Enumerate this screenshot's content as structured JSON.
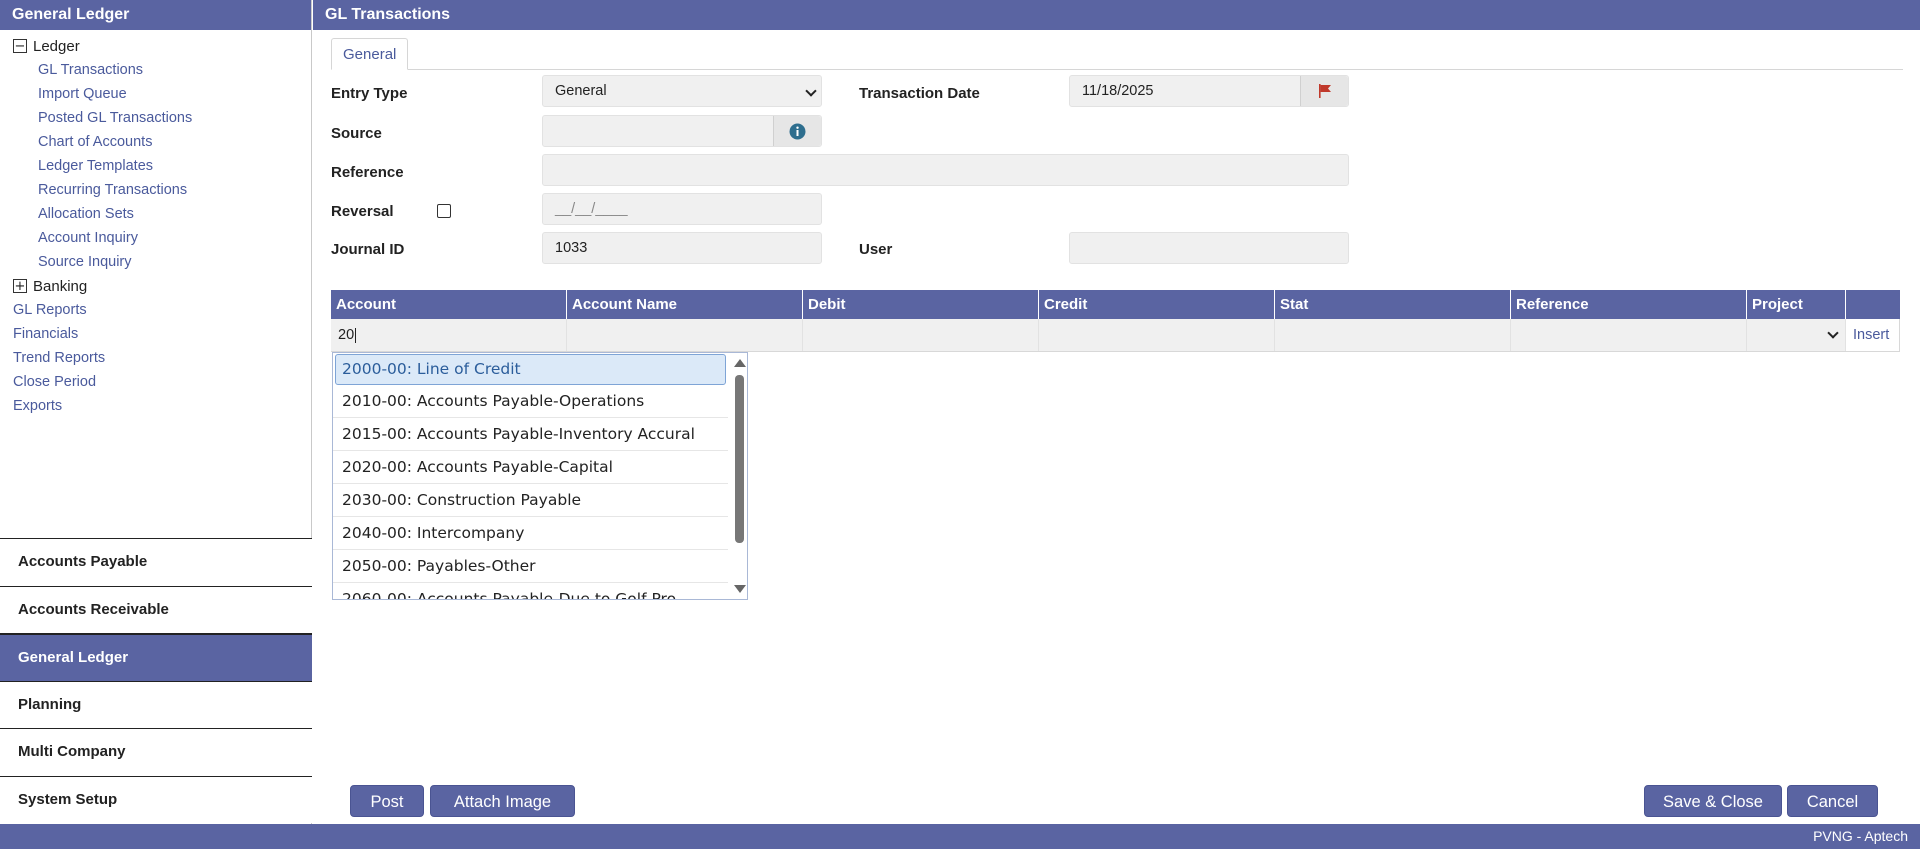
{
  "sidebar": {
    "title": "General Ledger",
    "ledger": {
      "toggle": "−",
      "label": "Ledger"
    },
    "ledger_items": [
      "GL Transactions",
      "Import Queue",
      "Posted GL Transactions",
      "Chart of Accounts",
      "Ledger Templates",
      "Recurring Transactions",
      "Allocation Sets",
      "Account Inquiry",
      "Source Inquiry"
    ],
    "banking": {
      "toggle": "+",
      "label": "Banking"
    },
    "top_links": [
      "GL Reports",
      "Financials",
      "Trend Reports",
      "Close Period",
      "Exports"
    ],
    "modules": [
      "Accounts Payable",
      "Accounts Receivable",
      "General Ledger",
      "Planning",
      "Multi Company",
      "System Setup"
    ],
    "active_module": "General Ledger"
  },
  "main": {
    "title": "GL Transactions",
    "tab": "General"
  },
  "form": {
    "entry_type_label": "Entry Type",
    "entry_type_value": "General",
    "transaction_date_label": "Transaction Date",
    "transaction_date_value": "11/18/2025",
    "source_label": "Source",
    "source_value": "",
    "reference_label": "Reference",
    "reference_value": "",
    "reversal_label": "Reversal",
    "reversal_checked": false,
    "reversal_date_placeholder": "__/__/____",
    "journal_id_label": "Journal ID",
    "journal_id_value": "1033",
    "user_label": "User",
    "user_value": ""
  },
  "grid": {
    "columns": [
      "Account",
      "Account Name",
      "Debit",
      "Credit",
      "Stat",
      "Reference",
      "Project"
    ],
    "row": {
      "account": "20",
      "insert": "Insert"
    }
  },
  "dropdown": {
    "items": [
      "2000-00: Line of Credit",
      "2010-00: Accounts Payable-Operations",
      "2015-00: Accounts Payable-Inventory Accural",
      "2020-00: Accounts Payable-Capital",
      "2030-00: Construction Payable",
      "2040-00: Intercompany",
      "2050-00: Payables-Other",
      "2060-00: Accounts Payable-Due to Golf Pro"
    ],
    "selected_index": 0
  },
  "buttons": {
    "post": "Post",
    "attach_image": "Attach Image",
    "save_close": "Save & Close",
    "cancel": "Cancel"
  },
  "footer": {
    "text": "PVNG - Aptech"
  },
  "colors": {
    "accent": "#5a64a2",
    "link": "#4a5a9c",
    "field_bg": "#f0f0f0",
    "flag": "#c0392b"
  }
}
